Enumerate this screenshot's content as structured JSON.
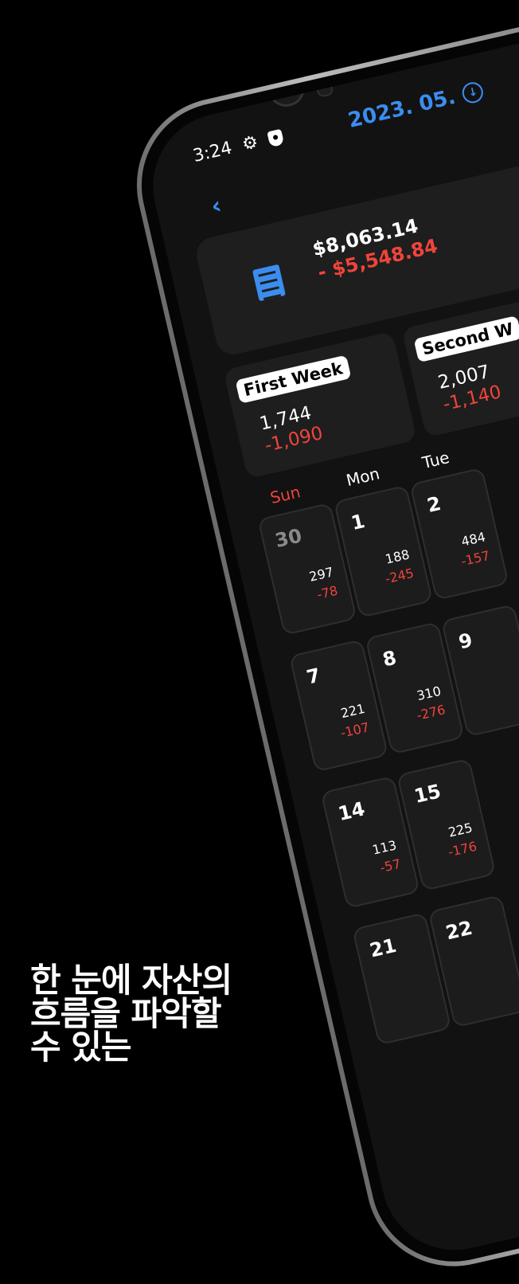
{
  "status_bar": {
    "time": "3:24"
  },
  "header": {
    "month": "2023. 05.",
    "back_label": "‹"
  },
  "summary": {
    "income": "$8,063.14",
    "expense": "- $5,548.84"
  },
  "weeks": [
    {
      "label": "First Week",
      "income": "1,744",
      "expense": "-1,090"
    },
    {
      "label": "Second W",
      "income": "2,007",
      "expense": "-1,140"
    }
  ],
  "weekdays": {
    "sun": "Sun",
    "mon": "Mon",
    "tue": "Tue"
  },
  "days": {
    "d30": {
      "num": "30",
      "income": "297",
      "expense": "-78"
    },
    "d1": {
      "num": "1",
      "income": "188",
      "expense": "-245"
    },
    "d2": {
      "num": "2",
      "income": "484",
      "expense": "-157"
    },
    "d7": {
      "num": "7",
      "income": "221",
      "expense": "-107"
    },
    "d8": {
      "num": "8",
      "income": "310",
      "expense": "-276"
    },
    "d9": {
      "num": "9"
    },
    "d14": {
      "num": "14",
      "income": "113",
      "expense": "-57"
    },
    "d15": {
      "num": "15",
      "income": "225",
      "expense": "-176"
    },
    "d21": {
      "num": "21"
    },
    "d22": {
      "num": "22"
    }
  },
  "tagline": {
    "line1": "한 눈에 자산의",
    "line2": "흐름을 파악할",
    "line3": "수 있는"
  }
}
